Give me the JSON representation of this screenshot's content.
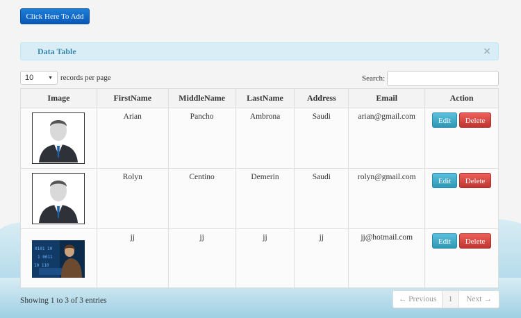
{
  "toolbar": {
    "add_label": "Click Here To Add"
  },
  "panel": {
    "title": "Data Table",
    "close_glyph": "×"
  },
  "length": {
    "value": "10",
    "suffix": "records per page"
  },
  "search": {
    "label": "Search:",
    "value": ""
  },
  "table": {
    "columns": [
      "Image",
      "FirstName",
      "MiddleName",
      "LastName",
      "Address",
      "Email",
      "Action"
    ],
    "rows": [
      {
        "image": "avatar-icon",
        "first": "Arian",
        "middle": "Pancho",
        "last": "Ambrona",
        "address": "Saudi",
        "email": "arian@gmail.com",
        "edit": "Edit",
        "delete": "Delete"
      },
      {
        "image": "avatar-icon",
        "first": "Rolyn",
        "middle": "Centino",
        "last": "Demerin",
        "address": "Saudi",
        "email": "rolyn@gmail.com",
        "edit": "Edit",
        "delete": "Delete"
      },
      {
        "image": "photo",
        "first": "jj",
        "middle": "jj",
        "last": "jj",
        "address": "jj",
        "email": "jj@hotmail.com",
        "edit": "Edit",
        "delete": "Delete"
      }
    ]
  },
  "footer": {
    "info": "Showing 1 to 3 of 3 entries",
    "prev": "← Previous",
    "page": "1",
    "next": "Next →"
  },
  "colors": {
    "add_button": "#0a57b8",
    "edit": "#2f96b4",
    "delete": "#bd362f",
    "info_panel": "#d9edf7"
  }
}
